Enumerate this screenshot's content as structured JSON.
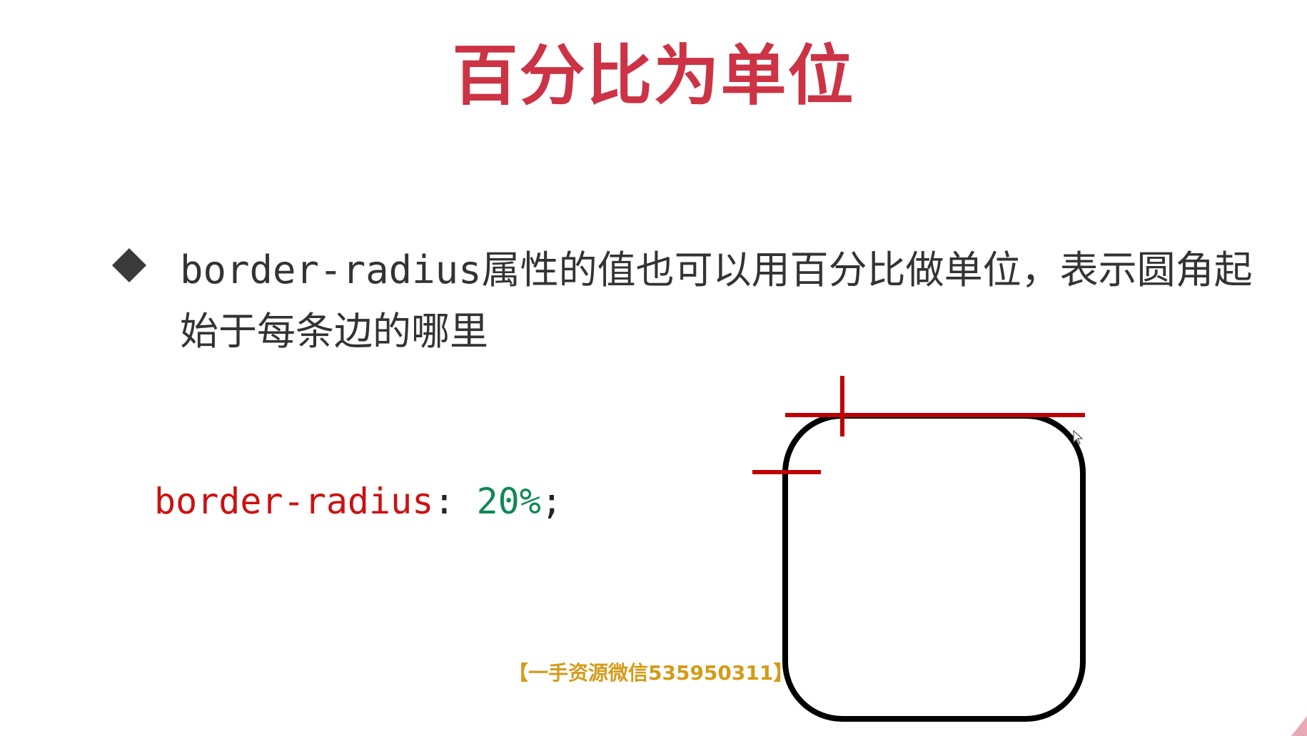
{
  "slide": {
    "title": "百分比为单位",
    "bullet": {
      "code_term": "border-radius",
      "text_rest": "属性的值也可以用百分比做单位，表示圆角起始于每条边的哪里"
    },
    "code": {
      "property": "border-radius",
      "colon": ": ",
      "value": "20%",
      "semicolon": ";"
    },
    "watermark": "【一手资源微信535950311】"
  },
  "colors": {
    "title": "#cc3344",
    "marker": "#c00000",
    "code_property": "#cc1111",
    "code_value": "#118855",
    "watermark": "#d49b1a"
  },
  "icons": {
    "bullet": "diamond-bullet-icon",
    "cursor": "mouse-pointer-icon"
  }
}
